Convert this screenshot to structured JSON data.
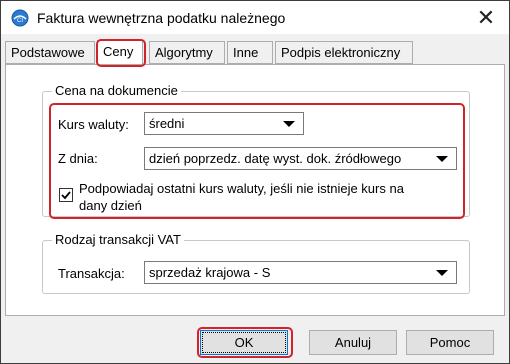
{
  "window": {
    "title": "Faktura wewnętrzna podatku należnego",
    "close_label": "✕",
    "app_icon": "app-icon"
  },
  "tabs": [
    {
      "label": "Podstawowe",
      "active": false
    },
    {
      "label": "Ceny",
      "active": true
    },
    {
      "label": "Algorytmy",
      "active": false
    },
    {
      "label": "Inne",
      "active": false
    },
    {
      "label": "Podpis elektroniczny",
      "active": false
    }
  ],
  "price_group": {
    "title": "Cena na dokumencie",
    "currency_rate_label": "Kurs waluty:",
    "currency_rate_value": "średni",
    "from_day_label": "Z dnia:",
    "from_day_value": "dzień poprzedz. datę wyst. dok. źródłowego",
    "suggest_rate_checked": true,
    "suggest_rate_label_line1": "Podpowiadaj ostatni kurs waluty, jeśli nie istnieje kurs na",
    "suggest_rate_label_line2": "dany dzień"
  },
  "vat_group": {
    "title": "Rodzaj transakcji VAT",
    "transaction_label": "Transakcja:",
    "transaction_value": "sprzedaż krajowa - S"
  },
  "buttons": {
    "ok": "OK",
    "cancel": "Anuluj",
    "help": "Pomoc"
  },
  "colors": {
    "highlight": "#d2232a",
    "dialog_bg": "#f0f0f0",
    "panel_bg": "#ffffff"
  }
}
